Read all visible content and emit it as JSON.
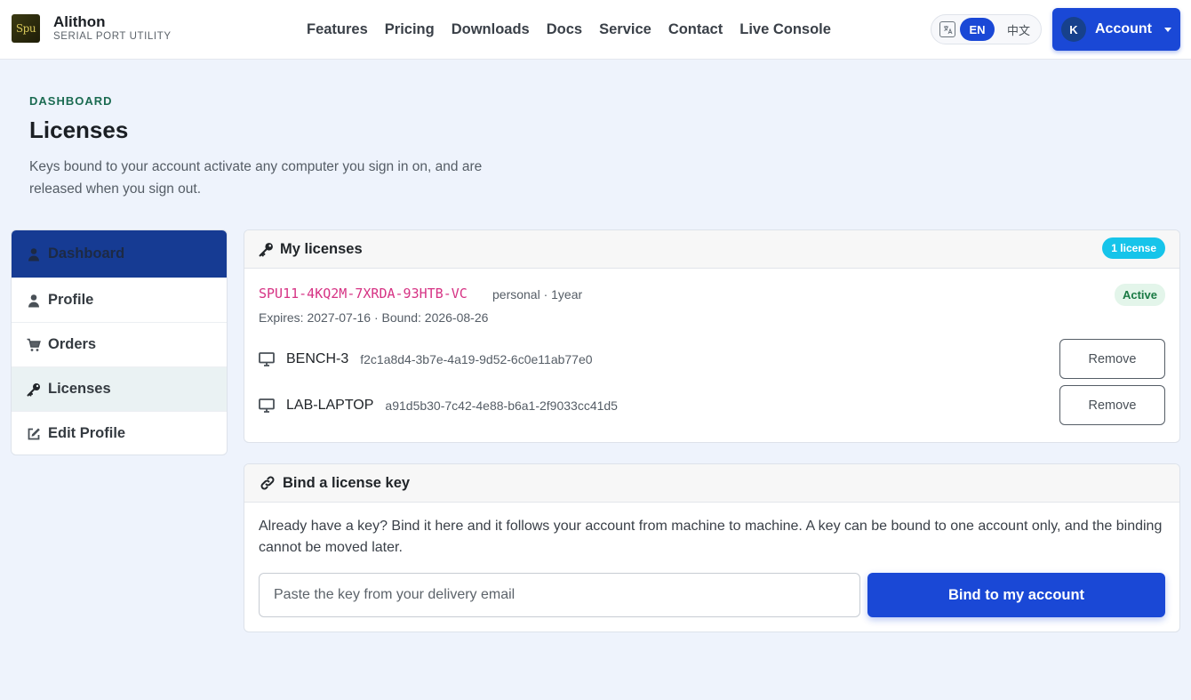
{
  "brand": {
    "logo_text": "Spu",
    "name": "Alithon",
    "subtitle": "SERIAL PORT UTILITY"
  },
  "nav": [
    "Features",
    "Pricing",
    "Downloads",
    "Docs",
    "Service",
    "Contact",
    "Live Console"
  ],
  "language": {
    "active": "EN",
    "other": "中文"
  },
  "account": {
    "avatar_letter": "K",
    "label": "Account"
  },
  "header": {
    "eyebrow": "DASHBOARD",
    "title": "Licenses",
    "description": "Keys bound to your account activate any computer you sign in on, and are released when you sign out."
  },
  "sidebar": {
    "items": [
      {
        "label": "Dashboard",
        "icon": "user-icon"
      },
      {
        "label": "Profile",
        "icon": "user-icon"
      },
      {
        "label": "Orders",
        "icon": "cart-icon"
      },
      {
        "label": "Licenses",
        "icon": "key-icon"
      },
      {
        "label": "Edit Profile",
        "icon": "edit-icon"
      }
    ],
    "active": "Licenses"
  },
  "licenses_card": {
    "title": "My licenses",
    "count_badge": "1 license",
    "license": {
      "key": "SPU11-4KQ2M-7XRDA-93HTB-VC",
      "meta": "personal · 1year",
      "status": "Active",
      "dates": "Expires: 2027-07-16 · Bound: 2026-08-26",
      "machines": [
        {
          "name": "BENCH-3",
          "id": "f2c1a8d4-3b7e-4a19-9d52-6c0e11ab77e0",
          "action": "Remove"
        },
        {
          "name": "LAB-LAPTOP",
          "id": "a91d5b30-7c42-4e88-b6a1-2f9033cc41d5",
          "action": "Remove"
        }
      ]
    }
  },
  "bind_card": {
    "title": "Bind a license key",
    "text": "Already have a key? Bind it here and it follows your account from machine to machine. A key can be bound to one account only, and the binding cannot be moved later.",
    "input_placeholder": "Paste the key from your delivery email",
    "input_value": "",
    "button": "Bind to my account"
  },
  "colors": {
    "primary": "#1a48d6",
    "sidebar_dashboard": "#163b93",
    "key_text": "#d63384",
    "badge": "#16c4ea"
  }
}
